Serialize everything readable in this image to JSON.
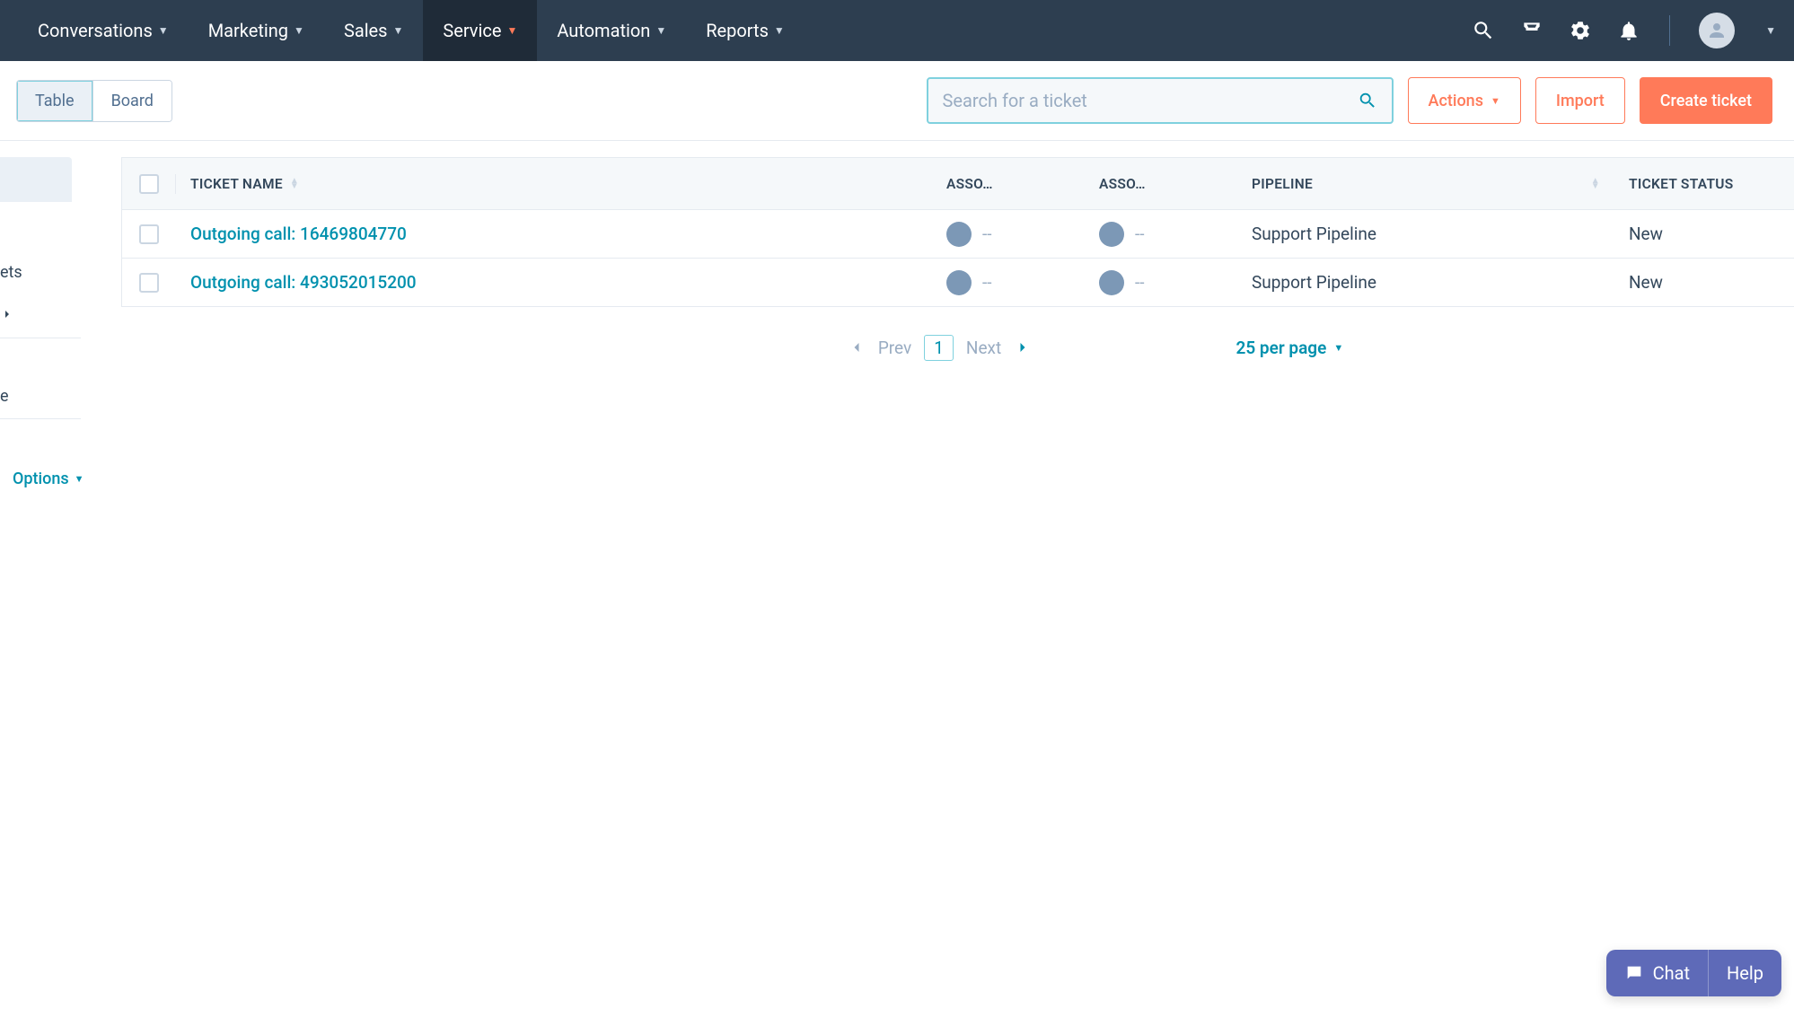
{
  "nav": {
    "items": [
      {
        "label": "Conversations"
      },
      {
        "label": "Marketing"
      },
      {
        "label": "Sales"
      },
      {
        "label": "Service",
        "active": true
      },
      {
        "label": "Automation"
      },
      {
        "label": "Reports"
      }
    ]
  },
  "toolbar": {
    "view_table": "Table",
    "view_board": "Board",
    "search_placeholder": "Search for a ticket",
    "actions": "Actions",
    "import": "Import",
    "create": "Create ticket"
  },
  "sidebar": {
    "label1": "ets",
    "label2": "e",
    "options": "Options"
  },
  "table": {
    "headers": {
      "ticket_name": "TICKET NAME",
      "asso1": "ASSO…",
      "asso2": "ASSO…",
      "pipeline": "PIPELINE",
      "status": "TICKET STATUS"
    },
    "rows": [
      {
        "name": "Outgoing call: 16469804770",
        "asso1": "--",
        "asso2": "--",
        "pipeline": "Support Pipeline",
        "status": "New"
      },
      {
        "name": "Outgoing call: 493052015200",
        "asso1": "--",
        "asso2": "--",
        "pipeline": "Support Pipeline",
        "status": "New"
      }
    ]
  },
  "pagination": {
    "prev": "Prev",
    "page": "1",
    "next": "Next",
    "per_page": "25 per page"
  },
  "chat": {
    "chat": "Chat",
    "help": "Help"
  }
}
